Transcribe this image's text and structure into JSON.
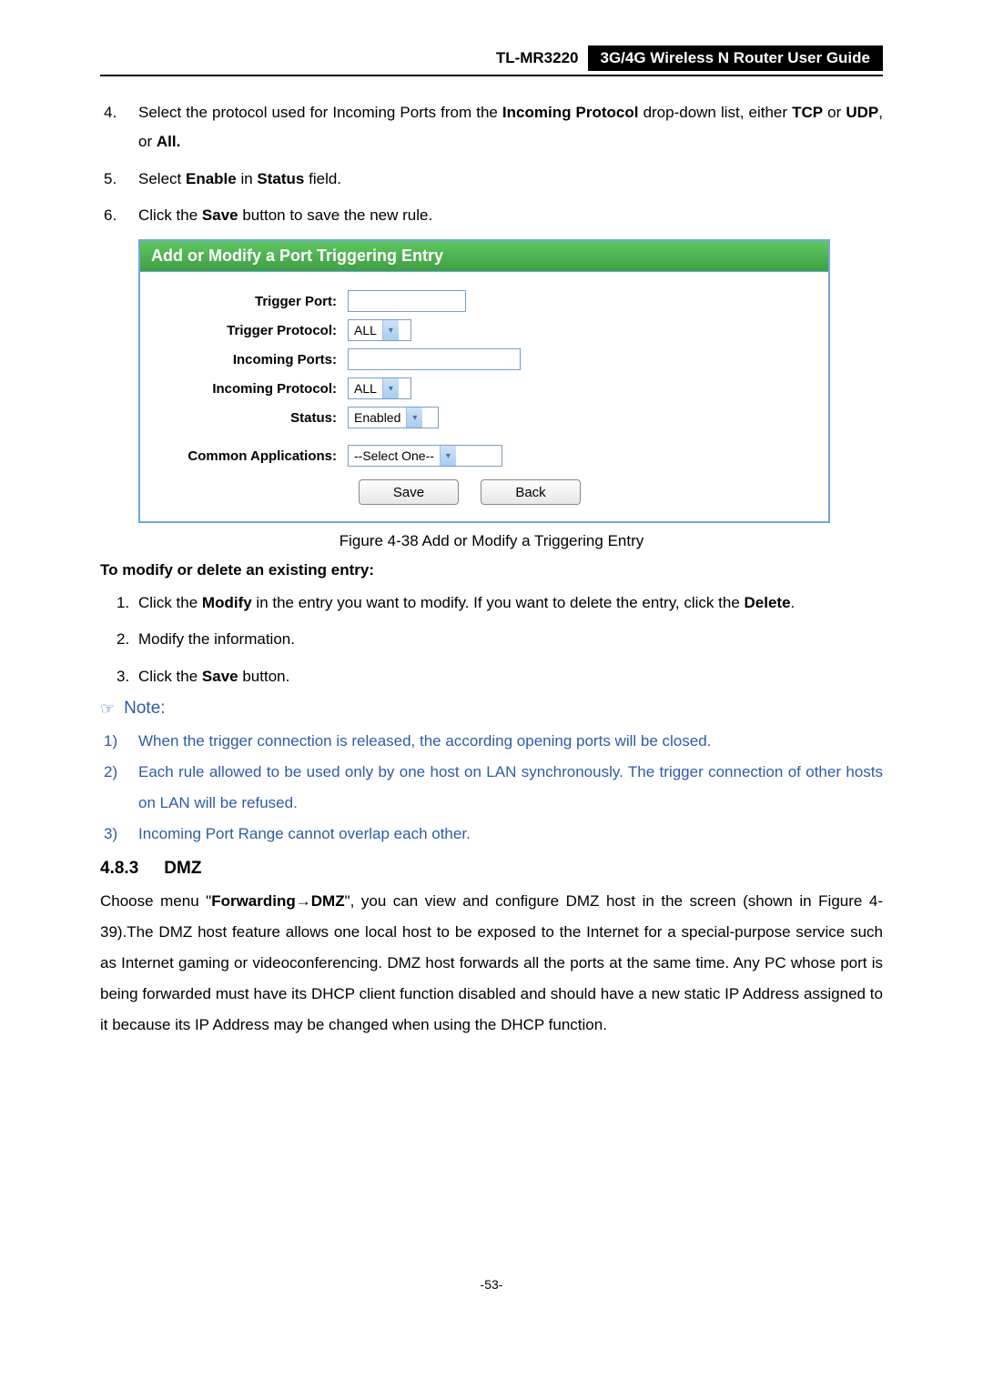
{
  "header": {
    "model": "TL-MR3220",
    "title": "3G/4G Wireless N Router User Guide"
  },
  "steps_a": [
    {
      "n": "4.",
      "pre": "Select the protocol used for Incoming Ports from the ",
      "b1": "Incoming Protocol",
      "mid": " drop-down list, either ",
      "b2": "TCP",
      "or1": " or ",
      "b3": "UDP",
      "or2": ", or ",
      "b4": "All."
    },
    {
      "n": "5.",
      "pre": "Select ",
      "b1": "Enable",
      "mid": " in ",
      "b2": "Status",
      "post": " field."
    },
    {
      "n": "6.",
      "pre": "Click the ",
      "b1": "Save",
      "post": " button to save the new rule."
    }
  ],
  "panel": {
    "title": "Add or Modify a Port Triggering Entry",
    "labels": {
      "triggerPort": "Trigger Port:",
      "triggerProtocol": "Trigger Protocol:",
      "incomingPorts": "Incoming Ports:",
      "incomingProtocol": "Incoming Protocol:",
      "status": "Status:",
      "commonApps": "Common Applications:"
    },
    "values": {
      "triggerProtocol": "ALL",
      "incomingProtocol": "ALL",
      "status": "Enabled",
      "commonApps": "--Select One--"
    },
    "buttons": {
      "save": "Save",
      "back": "Back"
    }
  },
  "caption": "Figure 4-38    Add or Modify a Triggering Entry",
  "subhead": "To modify or delete an existing entry:",
  "steps_b": [
    {
      "n": "1.",
      "pre": "Click the ",
      "b1": "Modify",
      "mid": " in the entry you want to modify. If you want to delete the entry, click the ",
      "b2": "Delete",
      "post": "."
    },
    {
      "n": "2.",
      "t": "Modify the information."
    },
    {
      "n": "3.",
      "pre": "Click the ",
      "b1": "Save",
      "post": " button."
    }
  ],
  "note": {
    "label": "Note:",
    "items": [
      {
        "n": "1)",
        "t": "When the trigger connection is released, the according opening ports will be closed."
      },
      {
        "n": "2)",
        "t": "Each rule allowed to be used only by one host on LAN synchronously. The trigger connection of other hosts on LAN will be refused."
      },
      {
        "n": "3)",
        "t": "Incoming Port Range cannot overlap each other."
      }
    ]
  },
  "section": {
    "num": "4.8.3",
    "title": "DMZ"
  },
  "para": {
    "p1a": "Choose menu \"",
    "p1b1": "Forwarding",
    "p1arrow": "→",
    "p1b2": "DMZ",
    "p1c": "\", you can view and configure DMZ host in the screen (shown in Figure 4-39).The DMZ host feature allows one local host to be exposed to the Internet for a special-purpose service such as Internet gaming or videoconferencing. DMZ host forwards all the ports at the same time. Any PC whose port is being forwarded must have its DHCP client function disabled and should have a new static IP Address assigned to it because its IP Address may be changed when using the DHCP function."
  },
  "page": "-53-"
}
